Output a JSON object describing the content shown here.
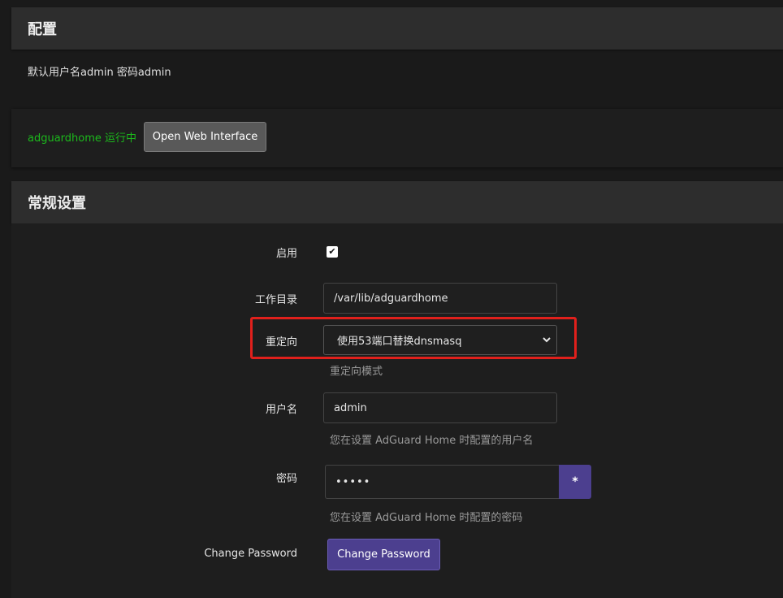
{
  "config_section": {
    "title": "配置",
    "note": "默认用户名admin 密码admin"
  },
  "status": {
    "running_text": "adguardhome 运行中",
    "open_web_label": "Open Web Interface"
  },
  "general_section": {
    "title": "常规设置",
    "enable": {
      "label": "启用",
      "checked": true
    },
    "workdir": {
      "label": "工作目录",
      "value": "/var/lib/adguardhome"
    },
    "redirect": {
      "label": "重定向",
      "selected": "使用53端口替换dnsmasq",
      "help": "重定向模式"
    },
    "username": {
      "label": "用户名",
      "value": "admin",
      "help": "您在设置 AdGuard Home 时配置的用户名"
    },
    "password": {
      "label": "密码",
      "masked_value": "•••••",
      "toggle_label": "*",
      "help": "您在设置 AdGuard Home 时配置的密码"
    },
    "change_password": {
      "label": "Change Password",
      "button_label": "Change Password"
    }
  },
  "colors": {
    "accent": "#4c3f8f",
    "running": "#1cb91c",
    "highlight": "#e0201c"
  }
}
